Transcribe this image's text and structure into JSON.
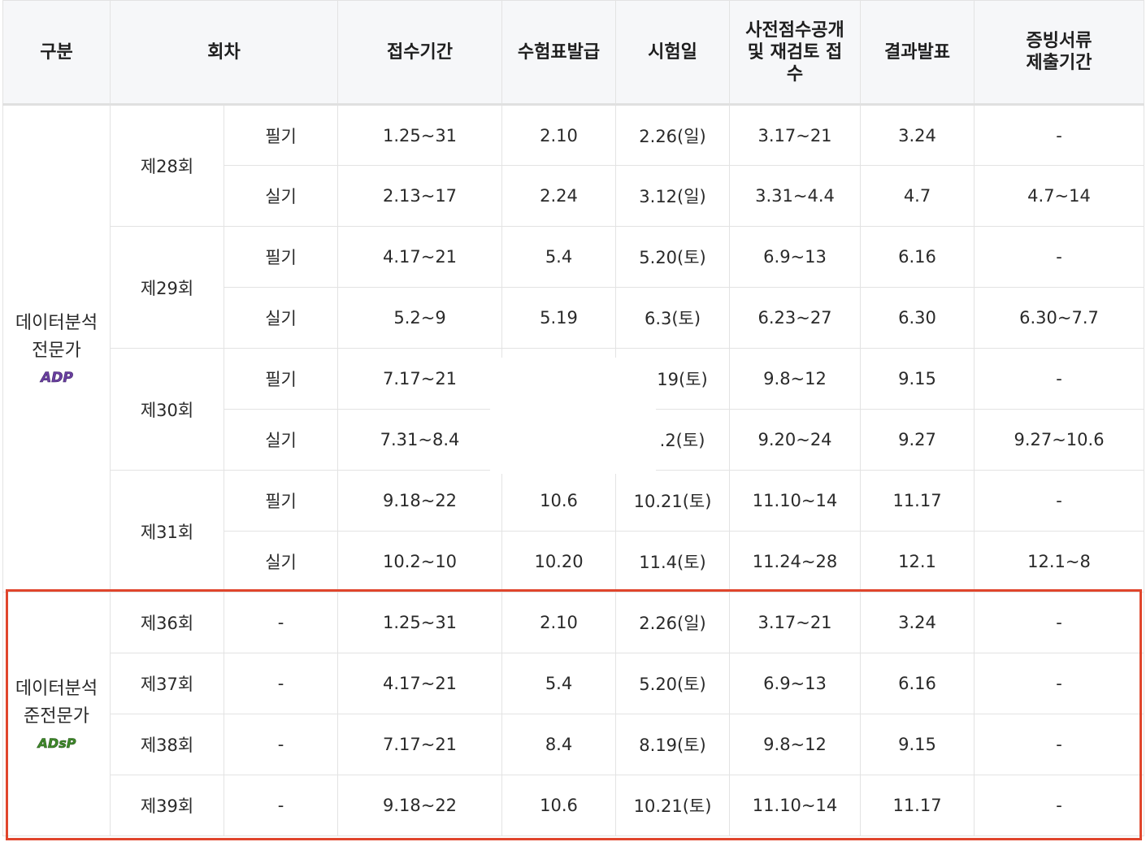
{
  "header": {
    "category": "구분",
    "round": "회차",
    "registration": "접수기간",
    "admission_ticket": "수험표발급",
    "exam_date": "시험일",
    "preliminary_score": "사전점수공개 및 재검토 접수",
    "result": "결과발표",
    "documents": "증빙서류 제출기간"
  },
  "groups": {
    "adp": {
      "name": "데이터분석 전문가",
      "logo_text": "ADP",
      "logo_color": "#6a3fa0"
    },
    "adsp": {
      "name": "데이터분석 준전문가",
      "logo_text": "ADsP",
      "logo_color": "#3f8a2a"
    }
  },
  "adp_rounds": [
    {
      "round": "제28회",
      "written": {
        "type": "필기",
        "reg": "1.25~31",
        "ticket": "2.10",
        "exam": "2.26(일)",
        "pre": "3.17~21",
        "result": "3.24",
        "docs": "-"
      },
      "practical": {
        "type": "실기",
        "reg": "2.13~17",
        "ticket": "2.24",
        "exam": "3.12(일)",
        "pre": "3.31~4.4",
        "result": "4.7",
        "docs": "4.7~14"
      }
    },
    {
      "round": "제29회",
      "written": {
        "type": "필기",
        "reg": "4.17~21",
        "ticket": "5.4",
        "exam": "5.20(토)",
        "pre": "6.9~13",
        "result": "6.16",
        "docs": "-"
      },
      "practical": {
        "type": "실기",
        "reg": "5.2~9",
        "ticket": "5.19",
        "exam": "6.3(토)",
        "pre": "6.23~27",
        "result": "6.30",
        "docs": "6.30~7.7"
      }
    },
    {
      "round": "제30회",
      "written": {
        "type": "필기",
        "reg": "7.17~21",
        "ticket": "",
        "exam": "19(토)",
        "pre": "9.8~12",
        "result": "9.15",
        "docs": "-"
      },
      "practical": {
        "type": "실기",
        "reg": "7.31~8.4",
        "ticket": "",
        "exam": ".2(토)",
        "pre": "9.20~24",
        "result": "9.27",
        "docs": "9.27~10.6"
      }
    },
    {
      "round": "제31회",
      "written": {
        "type": "필기",
        "reg": "9.18~22",
        "ticket": "10.6",
        "exam": "10.21(토)",
        "pre": "11.10~14",
        "result": "11.17",
        "docs": "-"
      },
      "practical": {
        "type": "실기",
        "reg": "10.2~10",
        "ticket": "10.20",
        "exam": "11.4(토)",
        "pre": "11.24~28",
        "result": "12.1",
        "docs": "12.1~8"
      }
    }
  ],
  "adsp_rounds": [
    {
      "round": "제36회",
      "type": "-",
      "reg": "1.25~31",
      "ticket": "2.10",
      "exam": "2.26(일)",
      "pre": "3.17~21",
      "result": "3.24",
      "docs": "-"
    },
    {
      "round": "제37회",
      "type": "-",
      "reg": "4.17~21",
      "ticket": "5.4",
      "exam": "5.20(토)",
      "pre": "6.9~13",
      "result": "6.16",
      "docs": "-"
    },
    {
      "round": "제38회",
      "type": "-",
      "reg": "7.17~21",
      "ticket": "8.4",
      "exam": "8.19(토)",
      "pre": "9.8~12",
      "result": "9.15",
      "docs": "-"
    },
    {
      "round": "제39회",
      "type": "-",
      "reg": "9.18~22",
      "ticket": "10.6",
      "exam": "10.21(토)",
      "pre": "11.10~14",
      "result": "11.17",
      "docs": "-"
    }
  ],
  "highlight_color": "#e0452c"
}
